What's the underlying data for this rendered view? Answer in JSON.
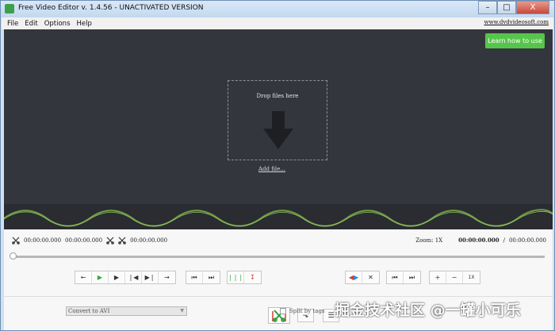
{
  "window": {
    "title": "Free Video Editor v. 1.4.56 - UNACTIVATED VERSION",
    "controls": [
      "–",
      "□",
      "X"
    ]
  },
  "menu": {
    "items": [
      "File",
      "Edit",
      "Options",
      "Help"
    ],
    "site_link": "www.dvdvideosoft.com"
  },
  "canvas": {
    "learn_button": "Learn how to use",
    "drop_title": "Drop files here",
    "add_file": "Add file..."
  },
  "timeline": {
    "in_time": "00:00:00.000",
    "out_time": "00:00:00.000",
    "selection_time": "00:00:00.000",
    "zoom_label": "Zoom: 1X",
    "current_time": "00:00:00.000",
    "separator": "/",
    "duration": "00:00:00.000",
    "progress": 0
  },
  "toolbar": {
    "speed": "1X"
  },
  "output": {
    "format": "Convert to AVI",
    "split_label": "Split by tags",
    "watermark": "掘金技术社区 @一罐小可乐"
  }
}
